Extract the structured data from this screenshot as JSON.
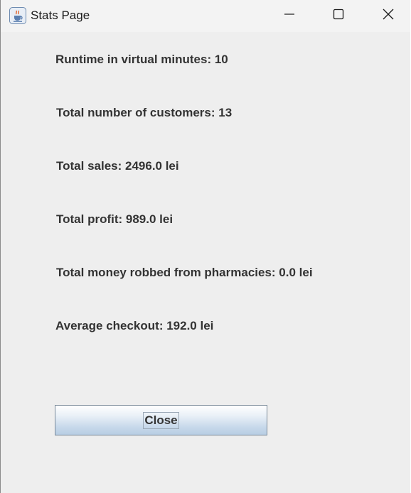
{
  "window": {
    "title": "Stats Page",
    "icon": "java-cup-icon",
    "controls": {
      "minimize_icon": "minimize-icon",
      "maximize_icon": "maximize-icon",
      "close_icon": "close-icon"
    }
  },
  "stats": {
    "runtime": "Runtime in virtual minutes: 10",
    "customers": "Total number of customers: 13",
    "sales": "Total sales: 2496.0 lei",
    "profit": "Total profit: 989.0 lei",
    "robbed": "Total money robbed from pharmacies: 0.0 lei",
    "average_checkout": "Average checkout: 192.0 lei"
  },
  "actions": {
    "close_label": "Close"
  },
  "colors": {
    "background": "#eeeeee",
    "titlebar": "#f3f3f3",
    "text": "#333333",
    "button_gradient_top": "#ffffff",
    "button_gradient_bottom": "#b8cde3"
  }
}
